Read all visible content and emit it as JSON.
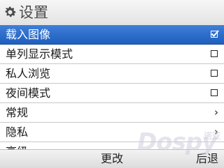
{
  "title": {
    "text": "设置",
    "icon": "gear-icon"
  },
  "menu": {
    "items": [
      {
        "label": "载入图像",
        "control": "checkbox",
        "checked": true,
        "selected": true
      },
      {
        "label": "单列显示模式",
        "control": "checkbox",
        "checked": false
      },
      {
        "label": "私人浏览",
        "control": "checkbox",
        "checked": false
      },
      {
        "label": "夜间模式",
        "control": "checkbox",
        "checked": false
      },
      {
        "label": "常规",
        "control": "submenu",
        "chevron": "›"
      },
      {
        "label": "隐私",
        "control": "submenu",
        "chevron": "›"
      },
      {
        "label": "高级",
        "control": "submenu",
        "chevron": "›"
      }
    ]
  },
  "softkeys": {
    "center": "更改",
    "right": "后退"
  },
  "watermark": {
    "text": "Dospy",
    "cn": "诺亚"
  },
  "colors": {
    "selection": "#2a6acb",
    "title_text": "#4c4c4c"
  }
}
